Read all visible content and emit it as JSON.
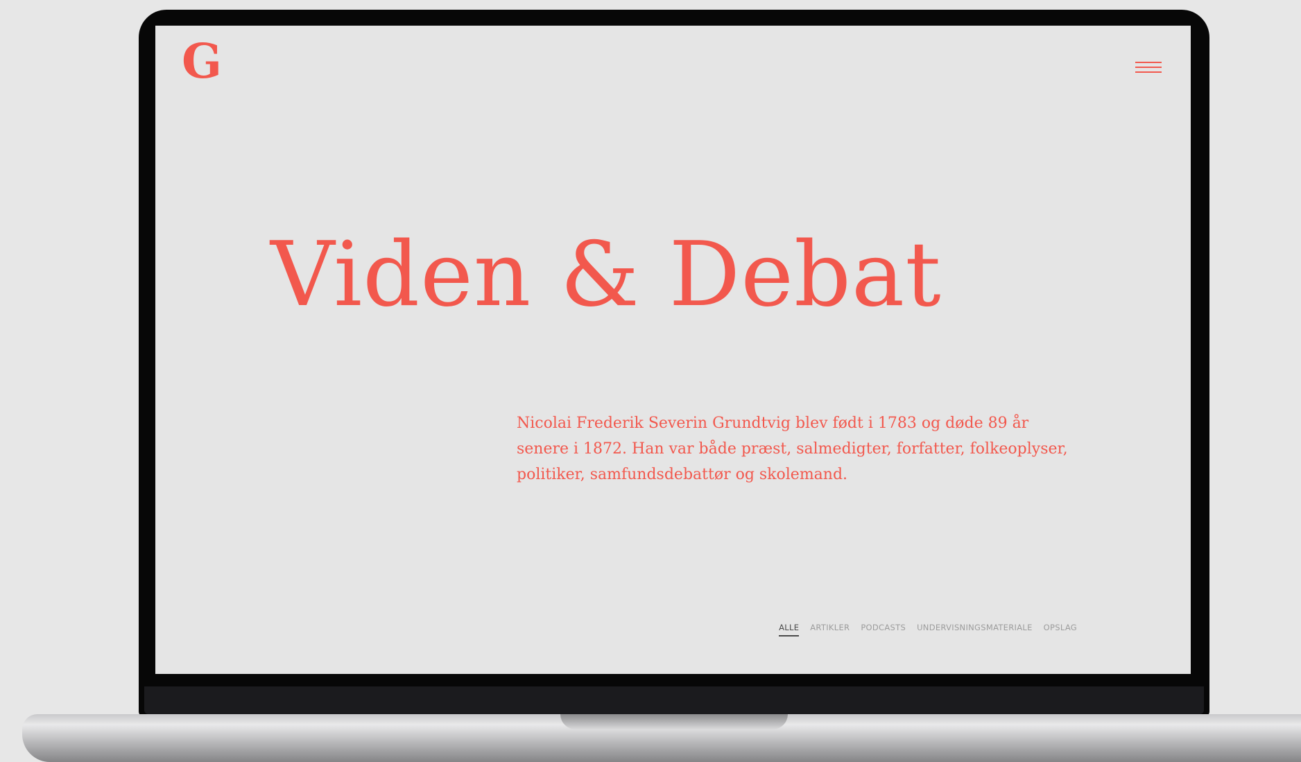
{
  "theme": {
    "accent": "#f2584d",
    "background": "#e5e5e5"
  },
  "header": {
    "logo_text": "G",
    "menu_icon": "hamburger-menu-icon"
  },
  "hero": {
    "title": "Viden & Debat",
    "intro": "Nicolai Frederik Severin Grundtvig blev født i 1783 og døde 89 år senere i 1872. Han var både præst, salmedigter, forfatter, folkeoplyser, politiker, samfundsdebattør og skolemand."
  },
  "filters": {
    "active_index": 0,
    "items": [
      {
        "label": "ALLE"
      },
      {
        "label": "ARTIKLER"
      },
      {
        "label": "PODCASTS"
      },
      {
        "label": "UNDERVISNINGSMATERIALE"
      },
      {
        "label": "OPSLAG"
      }
    ]
  }
}
